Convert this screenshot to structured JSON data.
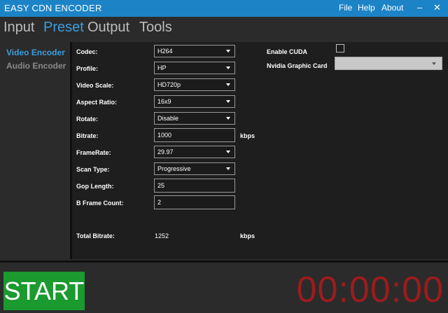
{
  "window": {
    "title": "EASY CDN ENCODER",
    "menu": [
      "File",
      "Help",
      "About"
    ],
    "controls": {
      "minimize": "‒",
      "close": "✕"
    }
  },
  "tabs": [
    "Input",
    "Preset",
    "Output",
    "Tools"
  ],
  "active_tab": "Preset",
  "subnav": [
    "Video Encoder",
    "Audio Encoder"
  ],
  "video": {
    "codec": {
      "label": "Codec:",
      "value": "H264"
    },
    "profile": {
      "label": "Profile:",
      "value": "HP"
    },
    "video_scale": {
      "label": "Video Scale:",
      "value": "HD720p"
    },
    "aspect_ratio": {
      "label": "Aspect Ratio:",
      "value": "16x9"
    },
    "rotate": {
      "label": "Rotate:",
      "value": "Disable"
    },
    "bitrate": {
      "label": "Bitrate:",
      "value": "1000",
      "unit": "kbps"
    },
    "framerate": {
      "label": "FrameRate:",
      "value": "29.97"
    },
    "scan_type": {
      "label": "Scan Type:",
      "value": "Progressive"
    },
    "gop_length": {
      "label": "Gop Length:",
      "value": "25"
    },
    "b_frame_count": {
      "label": "B Frame Count:",
      "value": "2"
    },
    "total_bitrate": {
      "label": "Total Bitrate:",
      "value": "1252",
      "unit": "kbps"
    }
  },
  "gpu": {
    "enable_cuda_label": "Enable CUDA",
    "enable_cuda_checked": false,
    "card_label": "Nvidia Graphic Card",
    "card_value": ""
  },
  "start_label": "START",
  "timer": "00:00:00",
  "colors": {
    "accent": "#1c84c6",
    "active_tab": "#3b9ddd",
    "start_button": "#1b9a2f",
    "timer": "#9b1c1c"
  }
}
